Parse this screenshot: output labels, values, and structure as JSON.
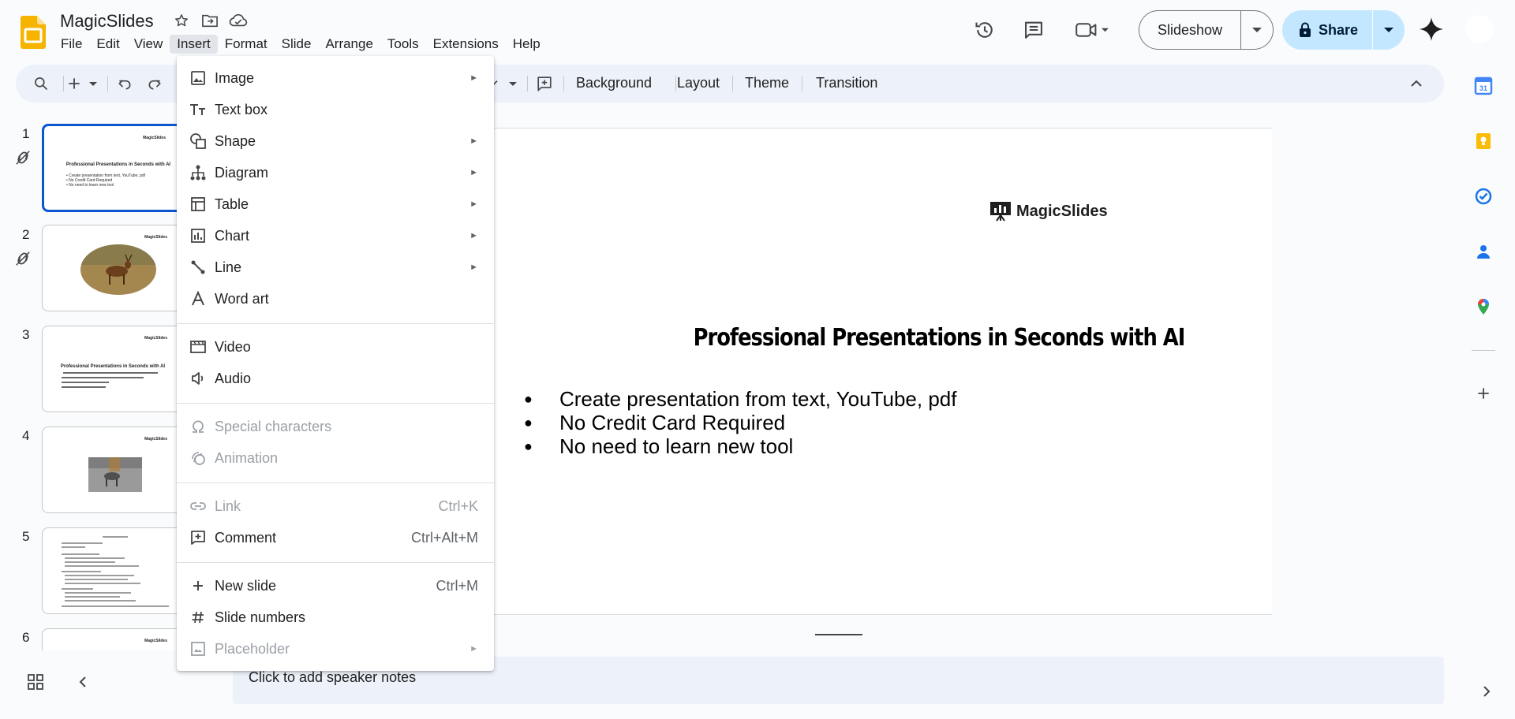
{
  "app": {
    "doc_title": "MagicSlides",
    "menus": [
      "File",
      "Edit",
      "View",
      "Insert",
      "Format",
      "Slide",
      "Arrange",
      "Tools",
      "Extensions",
      "Help"
    ],
    "active_menu": "Insert"
  },
  "header": {
    "slideshow_label": "Slideshow",
    "share_label": "Share"
  },
  "toolbar": {
    "background_label": "Background",
    "layout_label": "Layout",
    "theme_label": "Theme",
    "transition_label": "Transition"
  },
  "insert_menu": {
    "groups": [
      [
        {
          "label": "Image",
          "icon": "image-icon",
          "submenu": true
        },
        {
          "label": "Text box",
          "icon": "text-box-icon"
        },
        {
          "label": "Shape",
          "icon": "shape-icon",
          "submenu": true
        },
        {
          "label": "Diagram",
          "icon": "diagram-icon",
          "submenu": true
        },
        {
          "label": "Table",
          "icon": "table-icon",
          "submenu": true
        },
        {
          "label": "Chart",
          "icon": "chart-icon",
          "submenu": true
        },
        {
          "label": "Line",
          "icon": "line-icon",
          "submenu": true
        },
        {
          "label": "Word art",
          "icon": "word-art-icon"
        }
      ],
      [
        {
          "label": "Video",
          "icon": "video-icon"
        },
        {
          "label": "Audio",
          "icon": "audio-icon"
        }
      ],
      [
        {
          "label": "Special characters",
          "icon": "omega-icon",
          "disabled": true
        },
        {
          "label": "Animation",
          "icon": "animation-icon",
          "disabled": true
        }
      ],
      [
        {
          "label": "Link",
          "icon": "link-icon",
          "shortcut": "Ctrl+K",
          "disabled": true
        },
        {
          "label": "Comment",
          "icon": "comment-add-icon",
          "shortcut": "Ctrl+Alt+M"
        }
      ],
      [
        {
          "label": "New slide",
          "icon": "plus-icon",
          "shortcut": "Ctrl+M"
        },
        {
          "label": "Slide numbers",
          "icon": "hash-icon"
        },
        {
          "label": "Placeholder",
          "icon": "placeholder-icon",
          "submenu": true,
          "disabled": true
        }
      ]
    ]
  },
  "filmstrip": {
    "slides": [
      {
        "number": "1",
        "selected": true,
        "linked": true
      },
      {
        "number": "2",
        "linked": true
      },
      {
        "number": "3"
      },
      {
        "number": "4"
      },
      {
        "number": "5"
      },
      {
        "number": "6"
      }
    ]
  },
  "slide": {
    "logo_text": "MagicSlides",
    "title": "Professional Presentations in Seconds with AI",
    "bullets": [
      "Create presentation from text, YouTube, pdf",
      "No Credit Card Required",
      "No need to learn new tool"
    ]
  },
  "notes": {
    "placeholder": "Click to add speaker notes"
  },
  "colors": {
    "accent": "#0b57d0",
    "share_bg": "#c2e7ff",
    "toolbar_bg": "#edf2fa",
    "app_logo": "#f6b400"
  }
}
